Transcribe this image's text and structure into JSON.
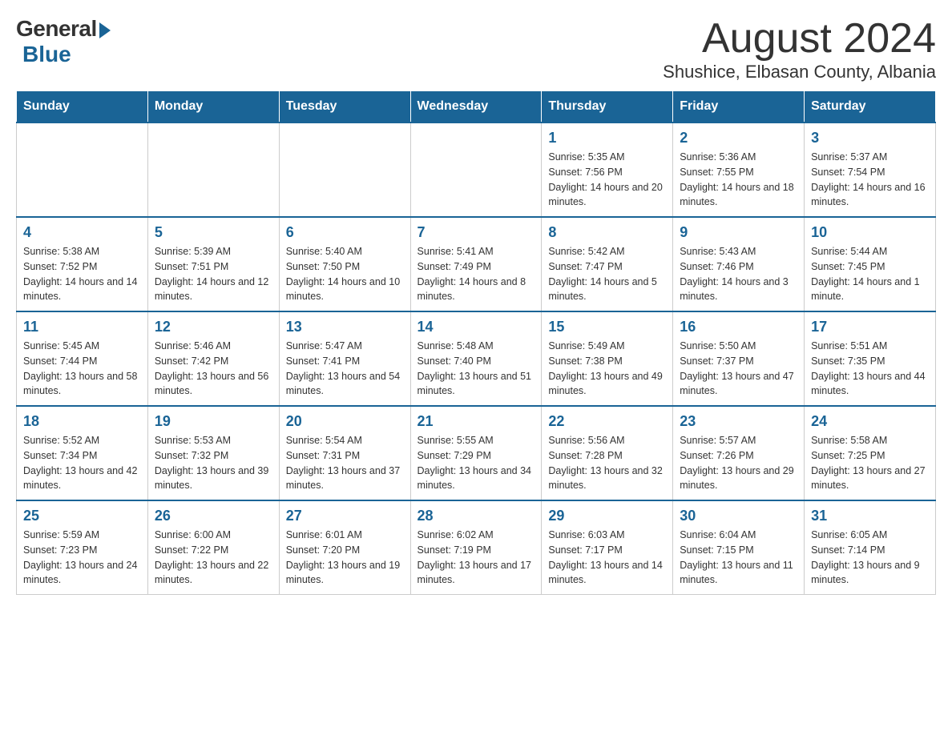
{
  "logo": {
    "general": "General",
    "blue": "Blue"
  },
  "title": "August 2024",
  "subtitle": "Shushice, Elbasan County, Albania",
  "days": [
    "Sunday",
    "Monday",
    "Tuesday",
    "Wednesday",
    "Thursday",
    "Friday",
    "Saturday"
  ],
  "weeks": [
    [
      {
        "day": "",
        "sunrise": "",
        "sunset": "",
        "daylight": ""
      },
      {
        "day": "",
        "sunrise": "",
        "sunset": "",
        "daylight": ""
      },
      {
        "day": "",
        "sunrise": "",
        "sunset": "",
        "daylight": ""
      },
      {
        "day": "",
        "sunrise": "",
        "sunset": "",
        "daylight": ""
      },
      {
        "day": "1",
        "sunrise": "Sunrise: 5:35 AM",
        "sunset": "Sunset: 7:56 PM",
        "daylight": "Daylight: 14 hours and 20 minutes."
      },
      {
        "day": "2",
        "sunrise": "Sunrise: 5:36 AM",
        "sunset": "Sunset: 7:55 PM",
        "daylight": "Daylight: 14 hours and 18 minutes."
      },
      {
        "day": "3",
        "sunrise": "Sunrise: 5:37 AM",
        "sunset": "Sunset: 7:54 PM",
        "daylight": "Daylight: 14 hours and 16 minutes."
      }
    ],
    [
      {
        "day": "4",
        "sunrise": "Sunrise: 5:38 AM",
        "sunset": "Sunset: 7:52 PM",
        "daylight": "Daylight: 14 hours and 14 minutes."
      },
      {
        "day": "5",
        "sunrise": "Sunrise: 5:39 AM",
        "sunset": "Sunset: 7:51 PM",
        "daylight": "Daylight: 14 hours and 12 minutes."
      },
      {
        "day": "6",
        "sunrise": "Sunrise: 5:40 AM",
        "sunset": "Sunset: 7:50 PM",
        "daylight": "Daylight: 14 hours and 10 minutes."
      },
      {
        "day": "7",
        "sunrise": "Sunrise: 5:41 AM",
        "sunset": "Sunset: 7:49 PM",
        "daylight": "Daylight: 14 hours and 8 minutes."
      },
      {
        "day": "8",
        "sunrise": "Sunrise: 5:42 AM",
        "sunset": "Sunset: 7:47 PM",
        "daylight": "Daylight: 14 hours and 5 minutes."
      },
      {
        "day": "9",
        "sunrise": "Sunrise: 5:43 AM",
        "sunset": "Sunset: 7:46 PM",
        "daylight": "Daylight: 14 hours and 3 minutes."
      },
      {
        "day": "10",
        "sunrise": "Sunrise: 5:44 AM",
        "sunset": "Sunset: 7:45 PM",
        "daylight": "Daylight: 14 hours and 1 minute."
      }
    ],
    [
      {
        "day": "11",
        "sunrise": "Sunrise: 5:45 AM",
        "sunset": "Sunset: 7:44 PM",
        "daylight": "Daylight: 13 hours and 58 minutes."
      },
      {
        "day": "12",
        "sunrise": "Sunrise: 5:46 AM",
        "sunset": "Sunset: 7:42 PM",
        "daylight": "Daylight: 13 hours and 56 minutes."
      },
      {
        "day": "13",
        "sunrise": "Sunrise: 5:47 AM",
        "sunset": "Sunset: 7:41 PM",
        "daylight": "Daylight: 13 hours and 54 minutes."
      },
      {
        "day": "14",
        "sunrise": "Sunrise: 5:48 AM",
        "sunset": "Sunset: 7:40 PM",
        "daylight": "Daylight: 13 hours and 51 minutes."
      },
      {
        "day": "15",
        "sunrise": "Sunrise: 5:49 AM",
        "sunset": "Sunset: 7:38 PM",
        "daylight": "Daylight: 13 hours and 49 minutes."
      },
      {
        "day": "16",
        "sunrise": "Sunrise: 5:50 AM",
        "sunset": "Sunset: 7:37 PM",
        "daylight": "Daylight: 13 hours and 47 minutes."
      },
      {
        "day": "17",
        "sunrise": "Sunrise: 5:51 AM",
        "sunset": "Sunset: 7:35 PM",
        "daylight": "Daylight: 13 hours and 44 minutes."
      }
    ],
    [
      {
        "day": "18",
        "sunrise": "Sunrise: 5:52 AM",
        "sunset": "Sunset: 7:34 PM",
        "daylight": "Daylight: 13 hours and 42 minutes."
      },
      {
        "day": "19",
        "sunrise": "Sunrise: 5:53 AM",
        "sunset": "Sunset: 7:32 PM",
        "daylight": "Daylight: 13 hours and 39 minutes."
      },
      {
        "day": "20",
        "sunrise": "Sunrise: 5:54 AM",
        "sunset": "Sunset: 7:31 PM",
        "daylight": "Daylight: 13 hours and 37 minutes."
      },
      {
        "day": "21",
        "sunrise": "Sunrise: 5:55 AM",
        "sunset": "Sunset: 7:29 PM",
        "daylight": "Daylight: 13 hours and 34 minutes."
      },
      {
        "day": "22",
        "sunrise": "Sunrise: 5:56 AM",
        "sunset": "Sunset: 7:28 PM",
        "daylight": "Daylight: 13 hours and 32 minutes."
      },
      {
        "day": "23",
        "sunrise": "Sunrise: 5:57 AM",
        "sunset": "Sunset: 7:26 PM",
        "daylight": "Daylight: 13 hours and 29 minutes."
      },
      {
        "day": "24",
        "sunrise": "Sunrise: 5:58 AM",
        "sunset": "Sunset: 7:25 PM",
        "daylight": "Daylight: 13 hours and 27 minutes."
      }
    ],
    [
      {
        "day": "25",
        "sunrise": "Sunrise: 5:59 AM",
        "sunset": "Sunset: 7:23 PM",
        "daylight": "Daylight: 13 hours and 24 minutes."
      },
      {
        "day": "26",
        "sunrise": "Sunrise: 6:00 AM",
        "sunset": "Sunset: 7:22 PM",
        "daylight": "Daylight: 13 hours and 22 minutes."
      },
      {
        "day": "27",
        "sunrise": "Sunrise: 6:01 AM",
        "sunset": "Sunset: 7:20 PM",
        "daylight": "Daylight: 13 hours and 19 minutes."
      },
      {
        "day": "28",
        "sunrise": "Sunrise: 6:02 AM",
        "sunset": "Sunset: 7:19 PM",
        "daylight": "Daylight: 13 hours and 17 minutes."
      },
      {
        "day": "29",
        "sunrise": "Sunrise: 6:03 AM",
        "sunset": "Sunset: 7:17 PM",
        "daylight": "Daylight: 13 hours and 14 minutes."
      },
      {
        "day": "30",
        "sunrise": "Sunrise: 6:04 AM",
        "sunset": "Sunset: 7:15 PM",
        "daylight": "Daylight: 13 hours and 11 minutes."
      },
      {
        "day": "31",
        "sunrise": "Sunrise: 6:05 AM",
        "sunset": "Sunset: 7:14 PM",
        "daylight": "Daylight: 13 hours and 9 minutes."
      }
    ]
  ]
}
